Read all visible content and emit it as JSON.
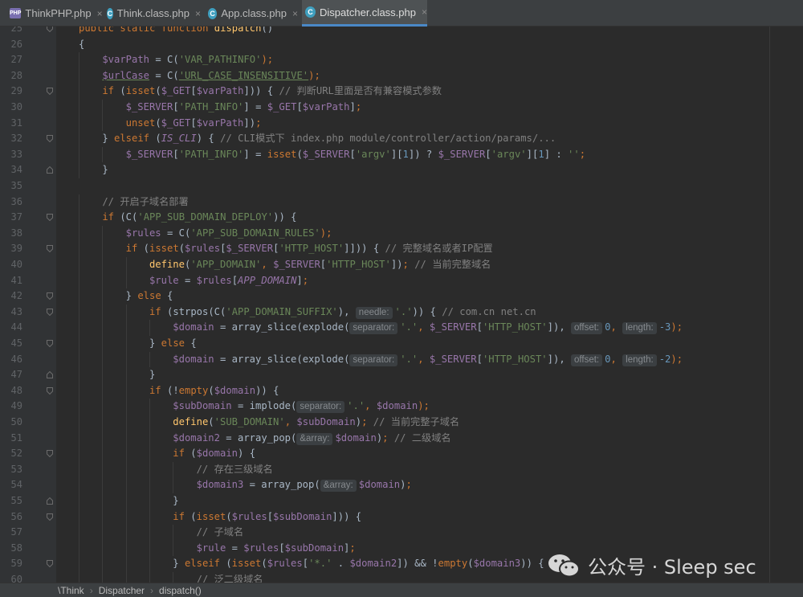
{
  "tabs": [
    {
      "label": "ThinkPHP.php",
      "icon": "php-file-icon",
      "active": false
    },
    {
      "label": "Think.class.php",
      "icon": "class-icon",
      "active": false
    },
    {
      "label": "App.class.php",
      "icon": "class-icon",
      "active": false
    },
    {
      "label": "Dispatcher.class.php",
      "icon": "class-icon",
      "active": true
    }
  ],
  "tab_close_glyph": "×",
  "code_lines": [
    {
      "n": "25",
      "indent": 0,
      "fold": "open",
      "tokens": [
        {
          "t": "public static function ",
          "c": "kw"
        },
        {
          "t": "dispatch",
          "c": "fn"
        },
        {
          "t": "()",
          "c": ""
        }
      ]
    },
    {
      "n": "26",
      "indent": 0,
      "fold": "",
      "tokens": [
        {
          "t": "{",
          "c": ""
        }
      ]
    },
    {
      "n": "27",
      "indent": 1,
      "fold": "",
      "tokens": [
        {
          "t": "$varPath",
          "c": "var"
        },
        {
          "t": " = C(",
          "c": ""
        },
        {
          "t": "'VAR_PATHINFO'",
          "c": "str"
        },
        {
          "t": ");",
          "c": "kw"
        }
      ]
    },
    {
      "n": "28",
      "indent": 1,
      "fold": "",
      "tokens": [
        {
          "t": "$urlCase",
          "c": "var uline"
        },
        {
          "t": " = C(",
          "c": ""
        },
        {
          "t": "'URL_CASE_INSENSITIVE'",
          "c": "str uline"
        },
        {
          "t": ");",
          "c": "kw"
        }
      ]
    },
    {
      "n": "29",
      "indent": 1,
      "fold": "open",
      "tokens": [
        {
          "t": "if",
          "c": "kw"
        },
        {
          "t": " (",
          "c": ""
        },
        {
          "t": "isset",
          "c": "kw"
        },
        {
          "t": "(",
          "c": ""
        },
        {
          "t": "$_GET",
          "c": "var"
        },
        {
          "t": "[",
          "c": ""
        },
        {
          "t": "$varPath",
          "c": "var"
        },
        {
          "t": "])) { ",
          "c": ""
        },
        {
          "t": "// 判断URL里面是否有兼容模式参数",
          "c": "cmt"
        }
      ]
    },
    {
      "n": "30",
      "indent": 2,
      "fold": "",
      "tokens": [
        {
          "t": "$_SERVER",
          "c": "var"
        },
        {
          "t": "[",
          "c": ""
        },
        {
          "t": "'PATH_INFO'",
          "c": "str"
        },
        {
          "t": "] = ",
          "c": ""
        },
        {
          "t": "$_GET",
          "c": "var"
        },
        {
          "t": "[",
          "c": ""
        },
        {
          "t": "$varPath",
          "c": "var"
        },
        {
          "t": "]",
          "c": ""
        },
        {
          "t": ";",
          "c": "kw"
        }
      ]
    },
    {
      "n": "31",
      "indent": 2,
      "fold": "",
      "tokens": [
        {
          "t": "unset",
          "c": "kw"
        },
        {
          "t": "(",
          "c": ""
        },
        {
          "t": "$_GET",
          "c": "var"
        },
        {
          "t": "[",
          "c": ""
        },
        {
          "t": "$varPath",
          "c": "var"
        },
        {
          "t": "])",
          "c": ""
        },
        {
          "t": ";",
          "c": "kw"
        }
      ]
    },
    {
      "n": "32",
      "indent": 1,
      "fold": "open",
      "tokens": [
        {
          "t": "} ",
          "c": ""
        },
        {
          "t": "elseif",
          "c": "kw"
        },
        {
          "t": " (",
          "c": ""
        },
        {
          "t": "IS_CLI",
          "c": "const"
        },
        {
          "t": ") { ",
          "c": ""
        },
        {
          "t": "// CLI模式下 index.php module/controller/action/params/...",
          "c": "cmt"
        }
      ]
    },
    {
      "n": "33",
      "indent": 2,
      "fold": "",
      "tokens": [
        {
          "t": "$_SERVER",
          "c": "var"
        },
        {
          "t": "[",
          "c": ""
        },
        {
          "t": "'PATH_INFO'",
          "c": "str"
        },
        {
          "t": "] = ",
          "c": ""
        },
        {
          "t": "isset",
          "c": "kw"
        },
        {
          "t": "(",
          "c": ""
        },
        {
          "t": "$_SERVER",
          "c": "var"
        },
        {
          "t": "[",
          "c": ""
        },
        {
          "t": "'argv'",
          "c": "str"
        },
        {
          "t": "][",
          "c": ""
        },
        {
          "t": "1",
          "c": "num"
        },
        {
          "t": "]) ? ",
          "c": ""
        },
        {
          "t": "$_SERVER",
          "c": "var"
        },
        {
          "t": "[",
          "c": ""
        },
        {
          "t": "'argv'",
          "c": "str"
        },
        {
          "t": "][",
          "c": ""
        },
        {
          "t": "1",
          "c": "num"
        },
        {
          "t": "] : ",
          "c": ""
        },
        {
          "t": "''",
          "c": "str"
        },
        {
          "t": ";",
          "c": "kw"
        }
      ]
    },
    {
      "n": "34",
      "indent": 1,
      "fold": "close",
      "tokens": [
        {
          "t": "}",
          "c": ""
        }
      ]
    },
    {
      "n": "35",
      "indent": 0,
      "fold": "",
      "tokens": []
    },
    {
      "n": "36",
      "indent": 1,
      "fold": "",
      "tokens": [
        {
          "t": "// 开启子域名部署",
          "c": "cmt"
        }
      ]
    },
    {
      "n": "37",
      "indent": 1,
      "fold": "open",
      "tokens": [
        {
          "t": "if",
          "c": "kw"
        },
        {
          "t": " (C(",
          "c": ""
        },
        {
          "t": "'APP_SUB_DOMAIN_DEPLOY'",
          "c": "str"
        },
        {
          "t": ")) {",
          "c": ""
        }
      ]
    },
    {
      "n": "38",
      "indent": 2,
      "fold": "",
      "tokens": [
        {
          "t": "$rules",
          "c": "var"
        },
        {
          "t": " = C(",
          "c": ""
        },
        {
          "t": "'APP_SUB_DOMAIN_RULES'",
          "c": "str"
        },
        {
          "t": ");",
          "c": "kw"
        }
      ]
    },
    {
      "n": "39",
      "indent": 2,
      "fold": "open",
      "tokens": [
        {
          "t": "if",
          "c": "kw"
        },
        {
          "t": " (",
          "c": ""
        },
        {
          "t": "isset",
          "c": "kw"
        },
        {
          "t": "(",
          "c": ""
        },
        {
          "t": "$rules",
          "c": "var"
        },
        {
          "t": "[",
          "c": ""
        },
        {
          "t": "$_SERVER",
          "c": "var"
        },
        {
          "t": "[",
          "c": ""
        },
        {
          "t": "'HTTP_HOST'",
          "c": "str"
        },
        {
          "t": "]])) { ",
          "c": ""
        },
        {
          "t": "// 完整域名或者IP配置",
          "c": "cmt"
        }
      ]
    },
    {
      "n": "40",
      "indent": 3,
      "fold": "",
      "tokens": [
        {
          "t": "define",
          "c": "fn"
        },
        {
          "t": "(",
          "c": ""
        },
        {
          "t": "'APP_DOMAIN'",
          "c": "str"
        },
        {
          "t": ", ",
          "c": "kw"
        },
        {
          "t": "$_SERVER",
          "c": "var"
        },
        {
          "t": "[",
          "c": ""
        },
        {
          "t": "'HTTP_HOST'",
          "c": "str"
        },
        {
          "t": "])",
          "c": ""
        },
        {
          "t": "; ",
          "c": "kw"
        },
        {
          "t": "// 当前完整域名",
          "c": "cmt"
        }
      ]
    },
    {
      "n": "41",
      "indent": 3,
      "fold": "",
      "tokens": [
        {
          "t": "$rule",
          "c": "var"
        },
        {
          "t": " = ",
          "c": ""
        },
        {
          "t": "$rules",
          "c": "var"
        },
        {
          "t": "[",
          "c": ""
        },
        {
          "t": "APP_DOMAIN",
          "c": "const"
        },
        {
          "t": "]",
          "c": ""
        },
        {
          "t": ";",
          "c": "kw"
        }
      ]
    },
    {
      "n": "42",
      "indent": 2,
      "fold": "open",
      "tokens": [
        {
          "t": "} ",
          "c": ""
        },
        {
          "t": "else",
          "c": "kw"
        },
        {
          "t": " {",
          "c": ""
        }
      ]
    },
    {
      "n": "43",
      "indent": 3,
      "fold": "open",
      "tokens": [
        {
          "t": "if",
          "c": "kw"
        },
        {
          "t": " (strpos(C(",
          "c": ""
        },
        {
          "t": "'APP_DOMAIN_SUFFIX'",
          "c": "str"
        },
        {
          "t": "), ",
          "c": ""
        },
        {
          "h": "needle:"
        },
        {
          "t": "'.'",
          "c": "str"
        },
        {
          "t": ")) { ",
          "c": ""
        },
        {
          "t": "// com.cn net.cn",
          "c": "cmt"
        }
      ]
    },
    {
      "n": "44",
      "indent": 4,
      "fold": "",
      "tokens": [
        {
          "t": "$domain",
          "c": "var"
        },
        {
          "t": " = array_slice(explode(",
          "c": ""
        },
        {
          "h": "separator:"
        },
        {
          "t": "'.'",
          "c": "str"
        },
        {
          "t": ", ",
          "c": "kw"
        },
        {
          "t": "$_SERVER",
          "c": "var"
        },
        {
          "t": "[",
          "c": ""
        },
        {
          "t": "'HTTP_HOST'",
          "c": "str"
        },
        {
          "t": "]), ",
          "c": ""
        },
        {
          "h": "offset:"
        },
        {
          "t": "0",
          "c": "num"
        },
        {
          "t": ", ",
          "c": "kw"
        },
        {
          "h": "length:"
        },
        {
          "t": "-3",
          "c": "num"
        },
        {
          "t": ");",
          "c": "kw"
        }
      ]
    },
    {
      "n": "45",
      "indent": 3,
      "fold": "open",
      "tokens": [
        {
          "t": "} ",
          "c": ""
        },
        {
          "t": "else",
          "c": "kw"
        },
        {
          "t": " {",
          "c": ""
        }
      ]
    },
    {
      "n": "46",
      "indent": 4,
      "fold": "",
      "tokens": [
        {
          "t": "$domain",
          "c": "var"
        },
        {
          "t": " = array_slice(explode(",
          "c": ""
        },
        {
          "h": "separator:"
        },
        {
          "t": "'.'",
          "c": "str"
        },
        {
          "t": ", ",
          "c": "kw"
        },
        {
          "t": "$_SERVER",
          "c": "var"
        },
        {
          "t": "[",
          "c": ""
        },
        {
          "t": "'HTTP_HOST'",
          "c": "str"
        },
        {
          "t": "]), ",
          "c": ""
        },
        {
          "h": "offset:"
        },
        {
          "t": "0",
          "c": "num"
        },
        {
          "t": ", ",
          "c": "kw"
        },
        {
          "h": "length:"
        },
        {
          "t": "-2",
          "c": "num"
        },
        {
          "t": ");",
          "c": "kw"
        }
      ]
    },
    {
      "n": "47",
      "indent": 3,
      "fold": "close",
      "tokens": [
        {
          "t": "}",
          "c": ""
        }
      ]
    },
    {
      "n": "48",
      "indent": 3,
      "fold": "open",
      "tokens": [
        {
          "t": "if",
          "c": "kw"
        },
        {
          "t": " (!",
          "c": ""
        },
        {
          "t": "empty",
          "c": "kw"
        },
        {
          "t": "(",
          "c": ""
        },
        {
          "t": "$domain",
          "c": "var"
        },
        {
          "t": ")) {",
          "c": ""
        }
      ]
    },
    {
      "n": "49",
      "indent": 4,
      "fold": "",
      "tokens": [
        {
          "t": "$subDomain",
          "c": "var"
        },
        {
          "t": " = implode(",
          "c": ""
        },
        {
          "h": "separator:"
        },
        {
          "t": "'.'",
          "c": "str"
        },
        {
          "t": ", ",
          "c": "kw"
        },
        {
          "t": "$domain",
          "c": "var"
        },
        {
          "t": ");",
          "c": "kw"
        }
      ]
    },
    {
      "n": "50",
      "indent": 4,
      "fold": "",
      "tokens": [
        {
          "t": "define",
          "c": "fn"
        },
        {
          "t": "(",
          "c": ""
        },
        {
          "t": "'SUB_DOMAIN'",
          "c": "str"
        },
        {
          "t": ", ",
          "c": "kw"
        },
        {
          "t": "$subDomain",
          "c": "var"
        },
        {
          "t": ")",
          "c": ""
        },
        {
          "t": "; ",
          "c": "kw"
        },
        {
          "t": "// 当前完整子域名",
          "c": "cmt"
        }
      ]
    },
    {
      "n": "51",
      "indent": 4,
      "fold": "",
      "tokens": [
        {
          "t": "$domain2",
          "c": "var"
        },
        {
          "t": " = array_pop(",
          "c": ""
        },
        {
          "h": "&array:"
        },
        {
          "t": "$domain",
          "c": "var"
        },
        {
          "t": ")",
          "c": ""
        },
        {
          "t": "; ",
          "c": "kw"
        },
        {
          "t": "// 二级域名",
          "c": "cmt"
        }
      ]
    },
    {
      "n": "52",
      "indent": 4,
      "fold": "open",
      "tokens": [
        {
          "t": "if",
          "c": "kw"
        },
        {
          "t": " (",
          "c": ""
        },
        {
          "t": "$domain",
          "c": "var"
        },
        {
          "t": ") {",
          "c": ""
        }
      ]
    },
    {
      "n": "53",
      "indent": 5,
      "fold": "",
      "tokens": [
        {
          "t": "// 存在三级域名",
          "c": "cmt"
        }
      ]
    },
    {
      "n": "54",
      "indent": 5,
      "fold": "",
      "tokens": [
        {
          "t": "$domain3",
          "c": "var"
        },
        {
          "t": " = array_pop(",
          "c": ""
        },
        {
          "h": "&array:"
        },
        {
          "t": "$domain",
          "c": "var"
        },
        {
          "t": ")",
          "c": ""
        },
        {
          "t": ";",
          "c": "kw"
        }
      ]
    },
    {
      "n": "55",
      "indent": 4,
      "fold": "close",
      "tokens": [
        {
          "t": "}",
          "c": ""
        }
      ]
    },
    {
      "n": "56",
      "indent": 4,
      "fold": "open",
      "tokens": [
        {
          "t": "if",
          "c": "kw"
        },
        {
          "t": " (",
          "c": ""
        },
        {
          "t": "isset",
          "c": "kw"
        },
        {
          "t": "(",
          "c": ""
        },
        {
          "t": "$rules",
          "c": "var"
        },
        {
          "t": "[",
          "c": ""
        },
        {
          "t": "$subDomain",
          "c": "var"
        },
        {
          "t": "])) {",
          "c": ""
        }
      ]
    },
    {
      "n": "57",
      "indent": 5,
      "fold": "",
      "tokens": [
        {
          "t": "// 子域名",
          "c": "cmt"
        }
      ]
    },
    {
      "n": "58",
      "indent": 5,
      "fold": "",
      "tokens": [
        {
          "t": "$rule",
          "c": "var"
        },
        {
          "t": " = ",
          "c": ""
        },
        {
          "t": "$rules",
          "c": "var"
        },
        {
          "t": "[",
          "c": ""
        },
        {
          "t": "$subDomain",
          "c": "var"
        },
        {
          "t": "]",
          "c": ""
        },
        {
          "t": ";",
          "c": "kw"
        }
      ]
    },
    {
      "n": "59",
      "indent": 4,
      "fold": "open",
      "tokens": [
        {
          "t": "} ",
          "c": ""
        },
        {
          "t": "elseif",
          "c": "kw"
        },
        {
          "t": " (",
          "c": ""
        },
        {
          "t": "isset",
          "c": "kw"
        },
        {
          "t": "(",
          "c": ""
        },
        {
          "t": "$rules",
          "c": "var"
        },
        {
          "t": "[",
          "c": ""
        },
        {
          "t": "'*.'",
          "c": "str"
        },
        {
          "t": " . ",
          "c": ""
        },
        {
          "t": "$domain2",
          "c": "var"
        },
        {
          "t": "]) && !",
          "c": ""
        },
        {
          "t": "empty",
          "c": "kw"
        },
        {
          "t": "(",
          "c": ""
        },
        {
          "t": "$domain3",
          "c": "var"
        },
        {
          "t": ")) {",
          "c": ""
        }
      ]
    },
    {
      "n": "60",
      "indent": 5,
      "fold": "",
      "tokens": [
        {
          "t": "// 泛二级域名",
          "c": "cmt"
        }
      ]
    }
  ],
  "breadcrumb": [
    "\\Think",
    "Dispatcher",
    "dispatch()"
  ],
  "watermark": {
    "text": "公众号 · Sleep sec",
    "icon": "wechat-icon"
  },
  "colors": {
    "keyword": "#cc7832",
    "variable": "#9876aa",
    "string": "#6a8759",
    "number": "#6897bb",
    "comment": "#808080",
    "function": "#ffc66d",
    "text": "#a9b7c6",
    "background": "#2b2b2b",
    "tab_active_underline": "#4a88c7"
  }
}
